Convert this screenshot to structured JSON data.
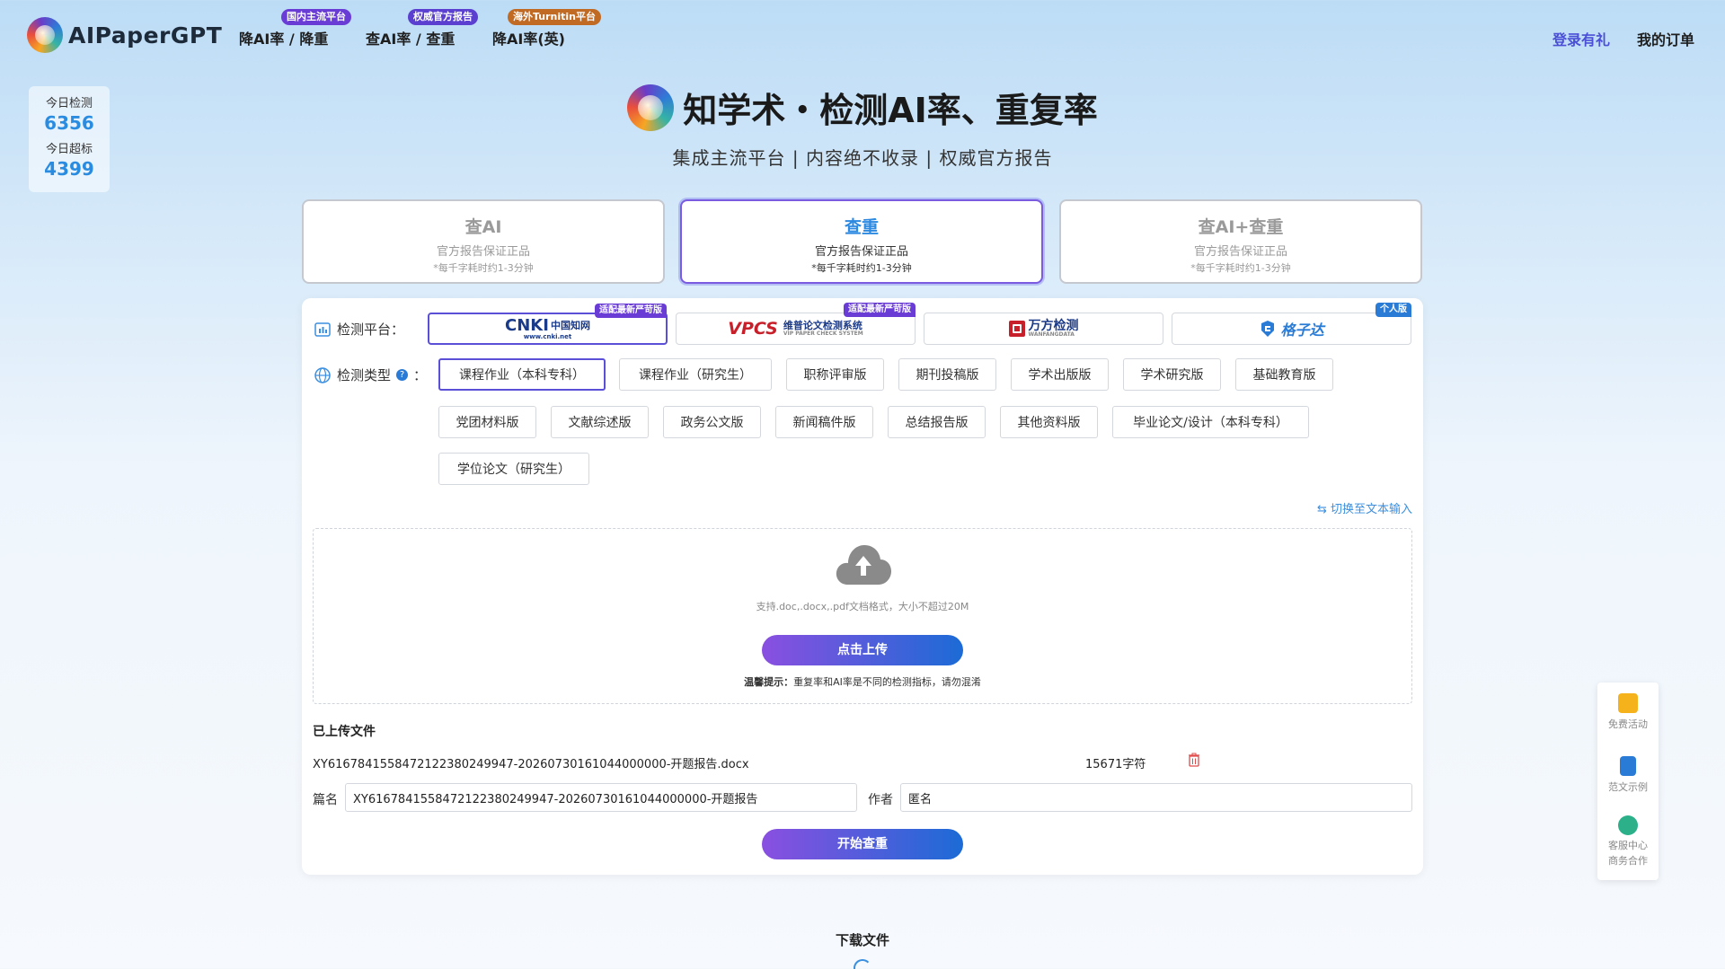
{
  "header": {
    "logo_text": "AIPaperGPT",
    "nav": [
      {
        "label": "降AI率 / 降重",
        "badge": "国内主流平台",
        "badge_color": "#6a3cd6"
      },
      {
        "label": "查AI率 / 查重",
        "badge": "权威官方报告",
        "badge_color": "#5a3fd0"
      },
      {
        "label": "降AI率(英)",
        "badge": "海外Turnitin平台",
        "badge_color": "#c06a24"
      }
    ],
    "login": "登录有礼",
    "orders": "我的订单"
  },
  "stats": {
    "today_checks_label": "今日检测",
    "today_checks_value": "6356",
    "today_over_label": "今日超标",
    "today_over_value": "4399"
  },
  "hero": {
    "title": "知学术・检测AI率、重复率",
    "subtitle": "集成主流平台 | 内容绝不收录 | 权威官方报告"
  },
  "modes": [
    {
      "title": "查AI",
      "desc": "官方报告保证正品",
      "note": "*每千字耗时约1-3分钟",
      "active": false
    },
    {
      "title": "查重",
      "desc": "官方报告保证正品",
      "note": "*每千字耗时约1-3分钟",
      "active": true
    },
    {
      "title": "查AI+查重",
      "desc": "官方报告保证正品",
      "note": "*每千字耗时约1-3分钟",
      "active": false
    }
  ],
  "platform_row": {
    "label": "检测平台：",
    "platforms": [
      {
        "name": "CNKI中国知网",
        "logo_main": "CNKI",
        "logo_sub": "中国知网",
        "logo_url": "www.cnki.net",
        "badge": "适配最新严苛版",
        "badge_color": "#6a3cd6",
        "icon": "cnki-logo-icon"
      },
      {
        "name": "VPCS维普论文检测系统",
        "logo_main": "VPCS",
        "logo_sub": "维普论文检测系统",
        "logo_en": "VIP PAPER CHECK SYSTEM",
        "badge": "适配最新严苛版",
        "badge_color": "#6a3cd6",
        "icon": "vpcs-logo-icon"
      },
      {
        "name": "万方检测",
        "logo_main": "万方检测",
        "logo_en": "WANFANGDATA",
        "badge": "",
        "badge_color": "",
        "icon": "wanfang-logo-icon"
      },
      {
        "name": "格子达",
        "logo_main": "格子达",
        "badge": "个人版",
        "badge_color": "#2a7bd6",
        "icon": "gezida-logo-icon"
      }
    ]
  },
  "type_row": {
    "label": "检测类型",
    "colon": "：",
    "types": [
      "课程作业（本科专科）",
      "课程作业（研究生）",
      "职称评审版",
      "期刊投稿版",
      "学术出版版",
      "学术研究版",
      "基础教育版",
      "党团材料版",
      "文献综述版",
      "政务公文版",
      "新闻稿件版",
      "总结报告版",
      "其他资料版",
      "毕业论文/设计（本科专科）",
      "学位论文（研究生）"
    ]
  },
  "upload": {
    "switch_label": "⇆ 切换至文本输入",
    "hint": "支持.doc,.docx,.pdf文档格式，大小不超过20M",
    "button": "点击上传",
    "tip_label": "温馨提示：",
    "tip_text": "重复率和AI率是不同的检测指标，请勿混淆"
  },
  "uploaded": {
    "title": "已上传文件",
    "file_name": "XY6167841558472122380249947-20260730161044000000-开题报告.docx",
    "char_count": "15671字符",
    "title_label": "篇名",
    "title_value": "XY6167841558472122380249947-20260730161044000000-开题报告",
    "author_label": "作者",
    "author_value": "匿名",
    "start_button": "开始查重"
  },
  "download": {
    "title": "下载文件"
  },
  "side": {
    "free": "免费活动",
    "sample": "范文示例",
    "service_1": "客服中心",
    "service_2": "商务合作"
  },
  "colors": {
    "accent_blue": "#2d8ae0",
    "accent_purple": "#5a4fd6",
    "gradient_start": "#8a4fe0",
    "gradient_end": "#1c6bd6"
  }
}
